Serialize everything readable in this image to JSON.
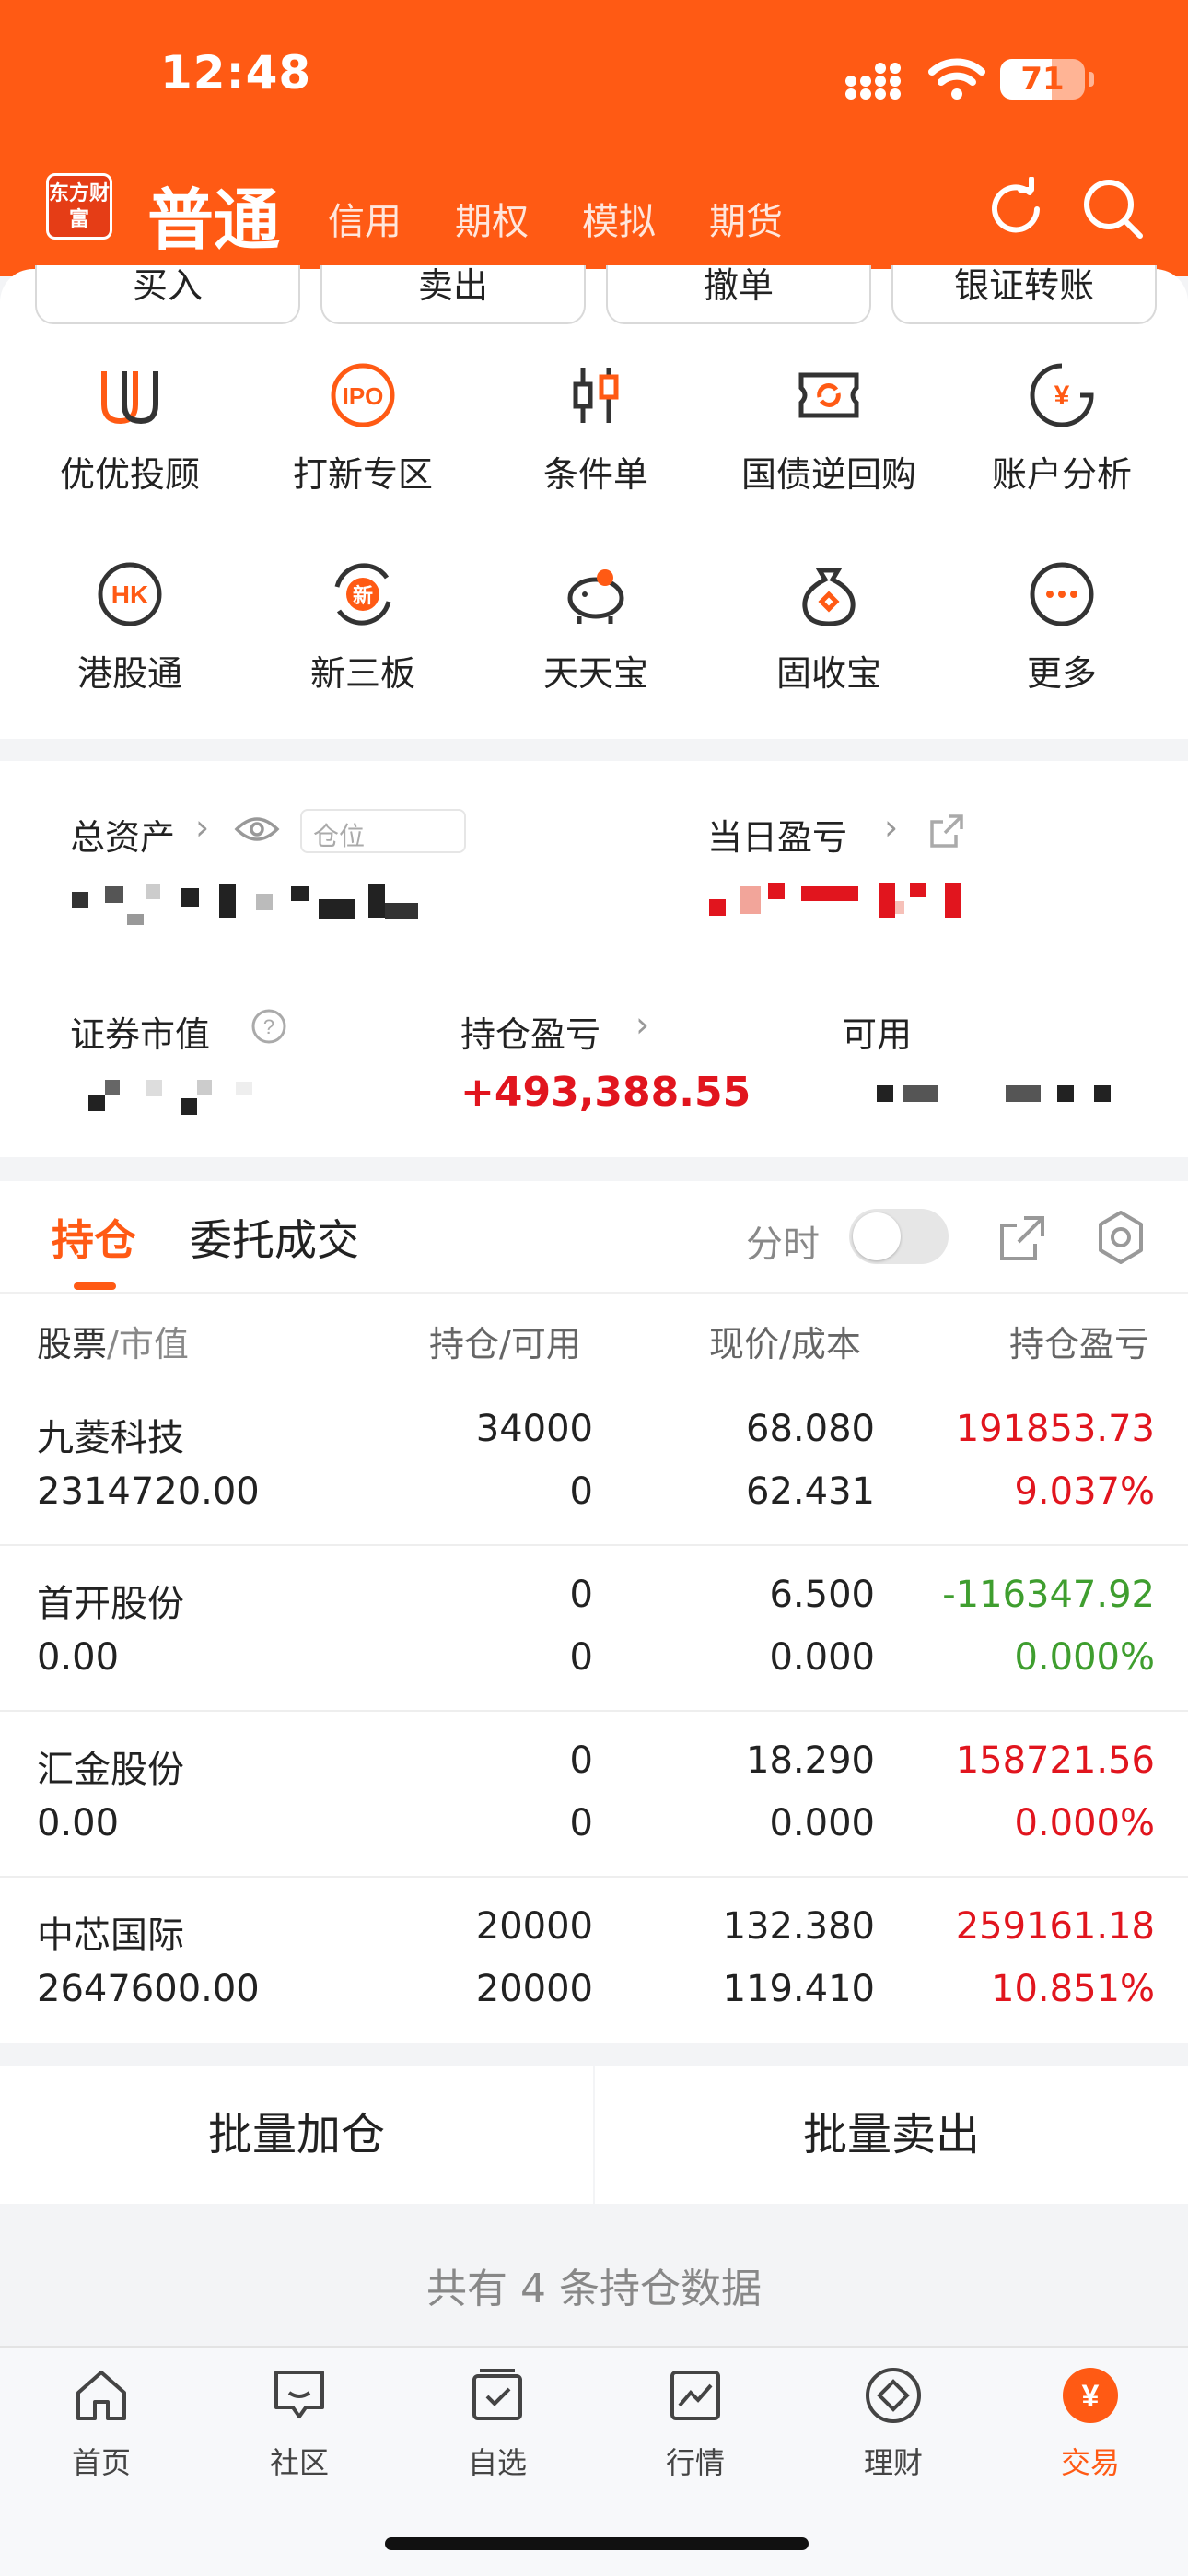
{
  "status_bar": {
    "time": "12:48",
    "battery": "71"
  },
  "header": {
    "logo_text": "东方财富",
    "account_types": [
      "普通",
      "信用",
      "期权",
      "模拟",
      "期货"
    ]
  },
  "quick_actions": [
    "买入",
    "卖出",
    "撤单",
    "银证转账"
  ],
  "features_row1": [
    "优优投顾",
    "打新专区",
    "条件单",
    "国债逆回购",
    "账户分析"
  ],
  "features_row2": [
    "港股通",
    "新三板",
    "天天宝",
    "固收宝",
    "更多"
  ],
  "assets": {
    "total_assets_label": "总资产",
    "position_hidden_label": "仓位",
    "daily_pl_label": "当日盈亏",
    "market_value_label": "证券市值",
    "holding_pl_label": "持仓盈亏",
    "holding_pl_value": "+493,388.55",
    "available_label": "可用"
  },
  "positions": {
    "tab_active": "持仓",
    "tab_other": "委托成交",
    "intraday_label": "分时",
    "columns": [
      "股票",
      "/市值",
      "持仓",
      "/可用",
      "现价",
      "/成本",
      "持仓盈亏"
    ],
    "rows": [
      {
        "name": "九菱科技",
        "market_value": "2314720.00",
        "holding": "34000",
        "available": "0",
        "price": "68.080",
        "cost": "62.431",
        "pl": "191853.73",
        "pl_pct": "9.037%",
        "tone": "red"
      },
      {
        "name": "首开股份",
        "market_value": "0.00",
        "holding": "0",
        "available": "0",
        "price": "6.500",
        "cost": "0.000",
        "pl": "-116347.92",
        "pl_pct": "0.000%",
        "tone": "green"
      },
      {
        "name": "汇金股份",
        "market_value": "0.00",
        "holding": "0",
        "available": "0",
        "price": "18.290",
        "cost": "0.000",
        "pl": "158721.56",
        "pl_pct": "0.000%",
        "tone": "red"
      },
      {
        "name": "中芯国际",
        "market_value": "2647600.00",
        "holding": "20000",
        "available": "20000",
        "price": "132.380",
        "cost": "119.410",
        "pl": "259161.18",
        "pl_pct": "10.851%",
        "tone": "red"
      }
    ],
    "batch_add": "批量加仓",
    "batch_sell": "批量卖出",
    "summary": "共有 4 条持仓数据"
  },
  "tab_bar": [
    "首页",
    "社区",
    "自选",
    "行情",
    "理财",
    "交易"
  ],
  "colors": {
    "brand": "#ff5a14",
    "up": "#e1151e",
    "down": "#3f9e2f"
  }
}
